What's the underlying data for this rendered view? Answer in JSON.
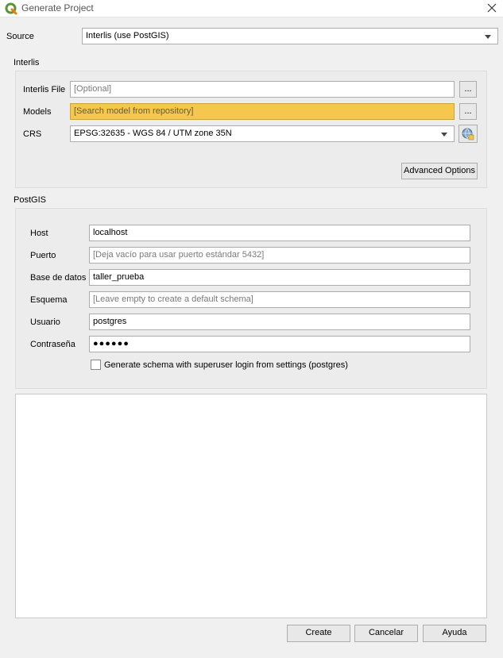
{
  "window": {
    "title": "Generate Project"
  },
  "source": {
    "label": "Source",
    "value": "Interlis (use PostGIS)"
  },
  "interlis": {
    "group_title": "Interlis",
    "file_label": "Interlis File",
    "file_placeholder": "[Optional]",
    "browse_label": "...",
    "models_label": "Models",
    "models_placeholder": "[Search model from repository]",
    "models_browse_label": "...",
    "crs_label": "CRS",
    "crs_value": "EPSG:32635 - WGS 84 / UTM zone 35N",
    "advanced_label": "Advanced Options"
  },
  "postgis": {
    "group_title": "PostGIS",
    "host_label": "Host",
    "host_value": "localhost",
    "port_label": "Puerto",
    "port_placeholder": "[Deja vacío para usar puerto estándar 5432]",
    "database_label": "Base de datos",
    "database_value": "taller_prueba",
    "schema_label": "Esquema",
    "schema_placeholder": "[Leave empty to create a default schema]",
    "user_label": "Usuario",
    "user_value": "postgres",
    "password_label": "Contraseña",
    "password_value": "●●●●●●",
    "superuser_label": "Generate schema with superuser login from settings (postgres)",
    "superuser_checked": false
  },
  "buttons": {
    "create": "Create",
    "cancel": "Cancelar",
    "help": "Ayuda"
  },
  "colors": {
    "highlight": "#f5c84d",
    "qgis_green": "#589632"
  }
}
